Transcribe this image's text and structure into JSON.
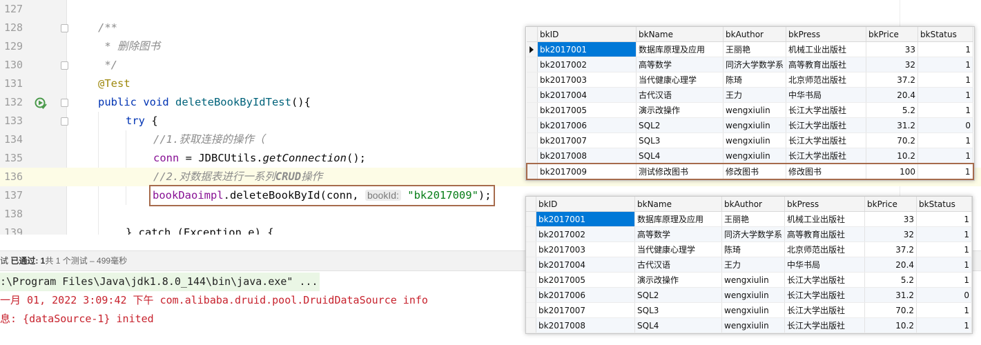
{
  "editor": {
    "lines": [
      {
        "num": "127"
      },
      {
        "num": "128",
        "text": "/**"
      },
      {
        "num": "129",
        "text": " * 删除图书"
      },
      {
        "num": "130",
        "text": " */"
      },
      {
        "num": "131",
        "text": "@Test"
      },
      {
        "num": "132",
        "kw": "public void ",
        "fn": "deleteBookByIdTest",
        "rest": "(){"
      },
      {
        "num": "133",
        "kw": "try",
        "rest": " {"
      },
      {
        "num": "134",
        "cm_prefix": "//1.",
        "cm_text": "获取连接的操作（"
      },
      {
        "num": "135",
        "field": "conn",
        "eq": " = JDBCUtils.",
        "call": "getConnection",
        "rest": "();"
      },
      {
        "num": "136",
        "cm_prefix": "//2.",
        "cm_text": "对数据表进行一系列",
        "cm_bold": "CRUD",
        "cm_tail": "操作"
      },
      {
        "num": "137",
        "field": "bookDaoimpl",
        "call": ".deleteBookById(",
        "arg": "conn",
        "comma": ", ",
        "hint": "bookId:",
        "str": "\"bk2017009\"",
        "rest": ");"
      },
      {
        "num": "138"
      },
      {
        "num": "139",
        "text": "} catch (Exception e) {"
      }
    ]
  },
  "status": {
    "prefix": "试 ",
    "passed": "已通过: 1",
    "detail": "共 1 个测试 – 499毫秒"
  },
  "console": {
    "lines": [
      ":\\Program Files\\Java\\jdk1.8.0_144\\bin\\java.exe\" ...",
      "一月 01, 2022 3:09:42 下午 com.alibaba.druid.pool.DruidDataSource info",
      "息: {dataSource-1} inited"
    ]
  },
  "table_before": {
    "headers": [
      "bkID",
      "bkName",
      "bkAuthor",
      "bkPress",
      "bkPrice",
      "bkStatus"
    ],
    "rows": [
      [
        "bk2017001",
        "数据库原理及应用",
        "王丽艳",
        "机械工业出版社",
        "33",
        "1"
      ],
      [
        "bk2017002",
        "高等数学",
        "同济大学数学系",
        "高等教育出版社",
        "32",
        "1"
      ],
      [
        "bk2017003",
        "当代健康心理学",
        "陈琦",
        "北京师范出版社",
        "37.2",
        "1"
      ],
      [
        "bk2017004",
        "古代汉语",
        "王力",
        "中华书局",
        "20.4",
        "1"
      ],
      [
        "bk2017005",
        "演示改操作",
        "wengxiulin",
        "长江大学出版社",
        "5.2",
        "1"
      ],
      [
        "bk2017006",
        "SQL2",
        "wengxiulin",
        "长江大学出版社",
        "31.2",
        "0"
      ],
      [
        "bk2017007",
        "SQL3",
        "wengxiulin",
        "长江大学出版社",
        "70.2",
        "1"
      ],
      [
        "bk2017008",
        "SQL4",
        "wengxiulin",
        "长江大学出版社",
        "10.2",
        "1"
      ],
      [
        "bk2017009",
        "测试修改图书",
        "修改图书",
        "修改图书",
        "100",
        "1"
      ]
    ]
  },
  "table_after": {
    "headers": [
      "bkID",
      "bkName",
      "bkAuthor",
      "bkPress",
      "bkPrice",
      "bkStatus"
    ],
    "rows": [
      [
        "bk2017001",
        "数据库原理及应用",
        "王丽艳",
        "机械工业出版社",
        "33",
        "1"
      ],
      [
        "bk2017002",
        "高等数学",
        "同济大学数学系",
        "高等教育出版社",
        "32",
        "1"
      ],
      [
        "bk2017003",
        "当代健康心理学",
        "陈琦",
        "北京师范出版社",
        "37.2",
        "1"
      ],
      [
        "bk2017004",
        "古代汉语",
        "王力",
        "中华书局",
        "20.4",
        "1"
      ],
      [
        "bk2017005",
        "演示改操作",
        "wengxiulin",
        "长江大学出版社",
        "5.2",
        "1"
      ],
      [
        "bk2017006",
        "SQL2",
        "wengxiulin",
        "长江大学出版社",
        "31.2",
        "0"
      ],
      [
        "bk2017007",
        "SQL3",
        "wengxiulin",
        "长江大学出版社",
        "70.2",
        "1"
      ],
      [
        "bk2017008",
        "SQL4",
        "wengxiulin",
        "长江大学出版社",
        "10.2",
        "1"
      ]
    ]
  },
  "colors": {
    "highlight_box": "#a66b4c",
    "selection": "#0078d7"
  }
}
